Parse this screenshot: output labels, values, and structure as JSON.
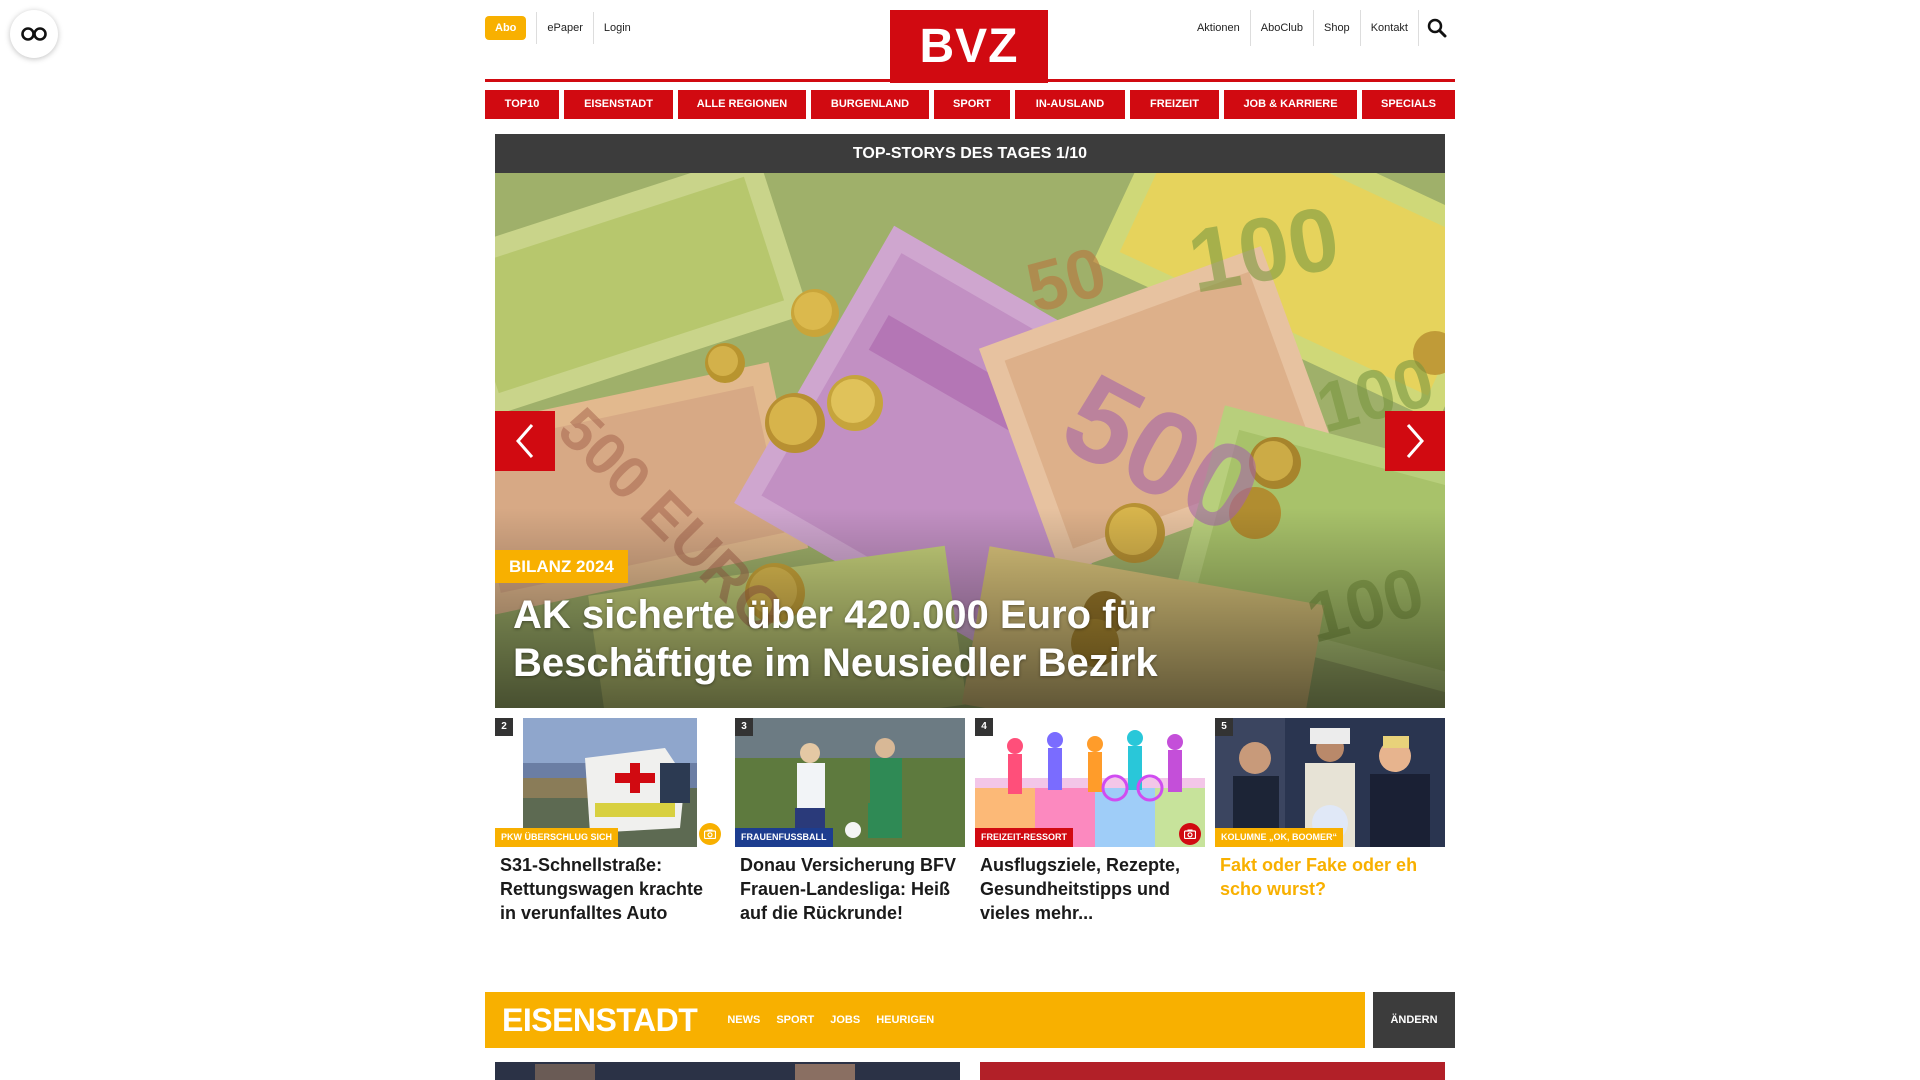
{
  "header": {
    "abo_label": "Abo",
    "left_links": [
      "ePaper",
      "Login"
    ],
    "logo_text": "BVZ",
    "right_links": [
      "Aktionen",
      "AboClub",
      "Shop",
      "Kontakt"
    ]
  },
  "nav": {
    "items": [
      "TOP10",
      "EISENSTADT",
      "ALLE REGIONEN",
      "BURGENLAND",
      "SPORT",
      "IN-AUSLAND",
      "FREIZEIT",
      "JOB & KARRIERE",
      "SPECIALS"
    ]
  },
  "top_stories": {
    "heading": "TOP-STORYS DES TAGES 1/10",
    "hero": {
      "tag": "BILANZ 2024",
      "title": "AK sicherte über 420.000 Euro für Beschäftigte im Neusiedler Bezirk"
    },
    "teasers": [
      {
        "number": "2",
        "label": "PKW ÜBERSCHLUG SICH",
        "title": "S31-Schnellstraße: Rettungswagen krachte in verunfalltes Auto",
        "label_color": "#f8b000"
      },
      {
        "number": "3",
        "label": "FRAUENFUSSBALL",
        "title": "Donau Versicherung BFV Frauen-Landesliga: Heiß auf die Rückrunde!",
        "label_color": "#1d3d8f"
      },
      {
        "number": "4",
        "label": "FREIZEIT-RESSORT",
        "title": "Ausflugsziele, Rezepte, Gesundheitstipps und vieles mehr...",
        "label_color": "#d10a11"
      },
      {
        "number": "5",
        "label": "KOLUMNE „OK, BOOMER“",
        "title": "Fakt oder Fake oder eh scho wurst?",
        "label_color": "#f8b000"
      }
    ]
  },
  "section": {
    "title": "EISENSTADT",
    "links": [
      "NEWS",
      "SPORT",
      "JOBS",
      "HEURIGEN"
    ],
    "change_label": "ÄNDERN"
  },
  "colors": {
    "brand_red": "#d10a11",
    "accent_yellow": "#f8b000",
    "dark_bar": "#3c3c3c"
  }
}
